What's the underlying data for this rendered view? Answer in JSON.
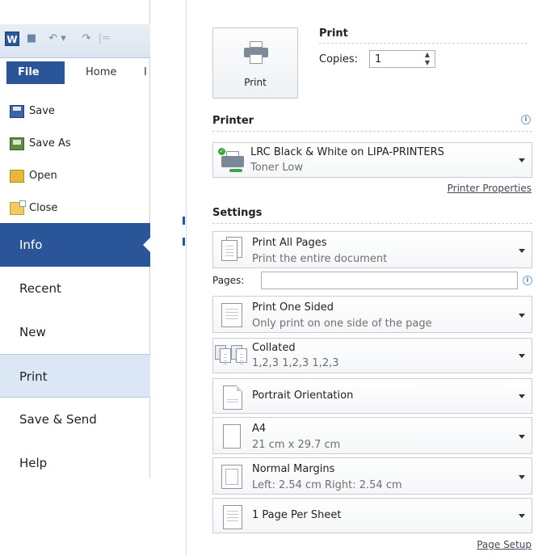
{
  "qat": {
    "app_icon": "word-icon",
    "app_letter": "W",
    "save_icon": "save-icon",
    "undo_glyph": "↶ ▾",
    "redo_glyph": "↷",
    "separator": "|="
  },
  "tabs": {
    "file": "File",
    "home": "Home",
    "next_partial": "I"
  },
  "file_commands": [
    {
      "label": "Save",
      "icon": "save-icon"
    },
    {
      "label": "Save As",
      "icon": "save-as-icon"
    },
    {
      "label": "Open",
      "icon": "folder-open-icon"
    },
    {
      "label": "Close",
      "icon": "folder-close-icon"
    }
  ],
  "nav": {
    "info": "Info",
    "recent": "Recent",
    "new": "New",
    "print": "Print",
    "save_send": "Save & Send",
    "help": "Help",
    "selected": "Info"
  },
  "print": {
    "button_label": "Print",
    "heading": "Print",
    "copies_label": "Copies:",
    "copies_value": "1"
  },
  "printer": {
    "heading": "Printer",
    "name": "LRC Black & White on LIPA-PRINTERS",
    "status": "Toner Low",
    "properties_link": "Printer Properties"
  },
  "settings": {
    "heading": "Settings",
    "pages_label": "Pages:",
    "pages_value": "",
    "items": [
      {
        "title": "Print All Pages",
        "subtitle": "Print the entire document",
        "icon": "pages-icon"
      },
      {
        "title": "Print One Sided",
        "subtitle": "Only print on one side of the page",
        "icon": "one-sided-icon"
      },
      {
        "title": "Collated",
        "subtitle": "1,2,3   1,2,3   1,2,3",
        "icon": "collated-icon"
      },
      {
        "title": "Portrait Orientation",
        "subtitle": "",
        "icon": "portrait-icon"
      },
      {
        "title": "A4",
        "subtitle": "21 cm x 29.7 cm",
        "icon": "paper-size-icon"
      },
      {
        "title": "Normal Margins",
        "subtitle": "Left:  2.54 cm   Right:  2.54 cm",
        "icon": "margins-icon"
      },
      {
        "title": "1 Page Per Sheet",
        "subtitle": "",
        "icon": "pages-per-sheet-icon"
      }
    ],
    "page_setup_link": "Page Setup"
  },
  "info_glyph": "i",
  "colors": {
    "accent": "#2a5699",
    "nav_hover": "#dce7f5",
    "link": "#404a57"
  }
}
